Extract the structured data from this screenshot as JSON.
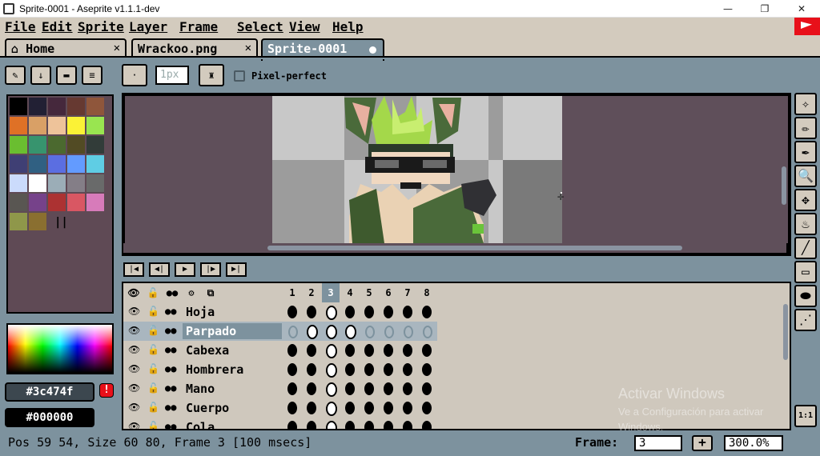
{
  "window": {
    "title": "Sprite-0001 - Aseprite v1.1.1-dev",
    "minimize": "—",
    "maximize": "❐",
    "close": "✕"
  },
  "menu": [
    "File",
    "Edit",
    "Sprite",
    "Layer",
    "Frame",
    "Select",
    "View",
    "Help"
  ],
  "tabs": [
    {
      "label": "Home",
      "close": "✕"
    },
    {
      "label": "Wrackoo.png",
      "close": "✕"
    },
    {
      "label": "Sprite-0001",
      "modified": true
    }
  ],
  "context_bar": {
    "brush_size": "1px",
    "pixel_perfect_label": "Pixel-perfect",
    "pixel_perfect_checked": false
  },
  "palette_colors": [
    "#000000",
    "#222034",
    "#45283c",
    "#663931",
    "#8f563b",
    "#df7126",
    "#d9a066",
    "#eec39a",
    "#fbf236",
    "#99e550",
    "#6abe30",
    "#37946e",
    "#4b692f",
    "#524b24",
    "#323c39",
    "#3f3f74",
    "#306082",
    "#5b6ee1",
    "#639bff",
    "#5fcde4",
    "#cbdbfc",
    "#ffffff",
    "#9badb7",
    "#847e87",
    "#696a6a",
    "#595652",
    "#76428a",
    "#ac3232",
    "#d95763",
    "#d77bba",
    "#8f974a",
    "#8a6f30"
  ],
  "foreground": {
    "value": "#3c474f",
    "color": "#3c474f"
  },
  "background": {
    "value": "#000000",
    "color": "#000000"
  },
  "timeline": {
    "frames": [
      "1",
      "2",
      "3",
      "4",
      "5",
      "6",
      "7",
      "8"
    ],
    "current_frame_index": 2,
    "layers": [
      {
        "name": "Hoja",
        "selected": false
      },
      {
        "name": "Parpado",
        "selected": true
      },
      {
        "name": "Cabexa",
        "selected": false
      },
      {
        "name": "Hombrera",
        "selected": false
      },
      {
        "name": "Mano",
        "selected": false
      },
      {
        "name": "Cuerpo",
        "selected": false
      },
      {
        "name": "Cola",
        "selected": false
      }
    ]
  },
  "tools": [
    "magic-wand-icon",
    "pencil-icon",
    "eyedropper-icon",
    "zoom-icon",
    "move-icon",
    "paint-bucket-icon",
    "line-icon",
    "rectangle-icon",
    "contour-icon",
    "blur-icon"
  ],
  "zoom_fit_label": "1:1",
  "watermark": {
    "line1": "Activar Windows",
    "line2": "Ve a Configuración para activar",
    "line3": "Windows."
  },
  "status": {
    "text": "Pos 59 54, Size 60 80, Frame 3 [100 msecs]",
    "frame_label": "Frame:",
    "frame_value": "3",
    "add_label": "+",
    "zoom_value": "300.0%"
  }
}
